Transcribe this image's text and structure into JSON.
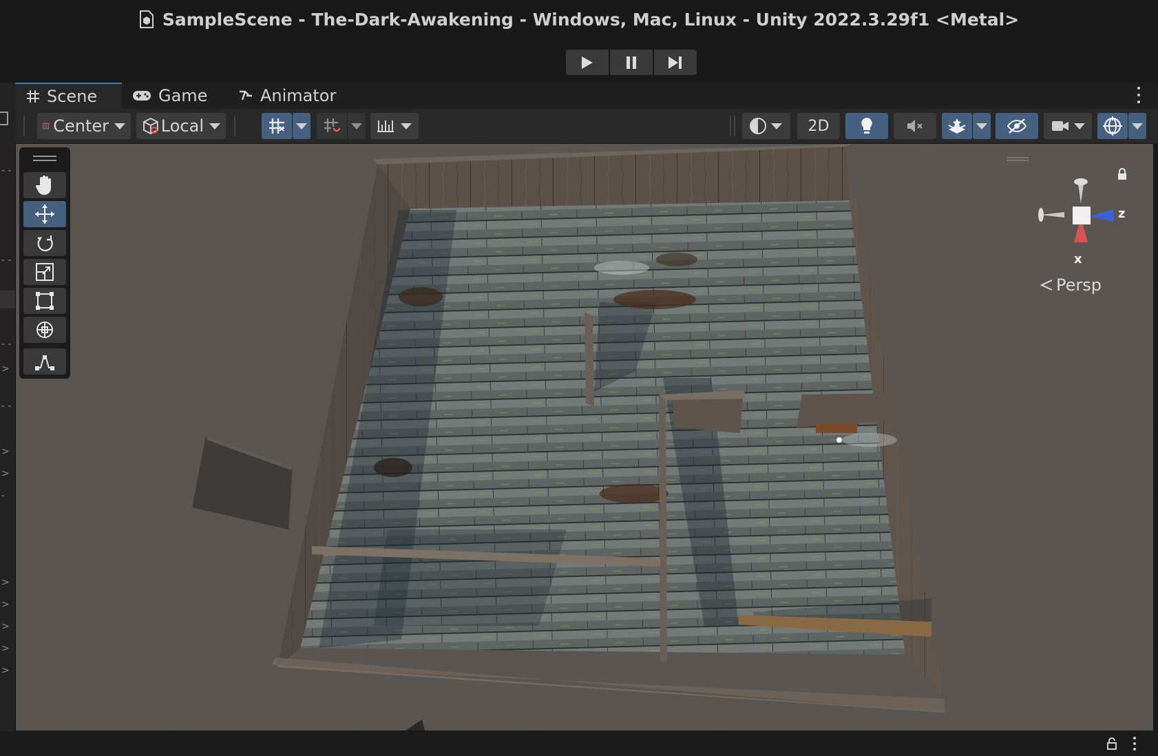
{
  "window": {
    "title": "SampleScene - The-Dark-Awakening - Windows, Mac, Linux - Unity 2022.3.29f1 <Metal>"
  },
  "play_controls": {
    "icons": [
      "play-icon",
      "pause-icon",
      "step-icon"
    ]
  },
  "tabs": [
    {
      "label": "Scene",
      "icon": "grid-hash-icon",
      "active": true
    },
    {
      "label": "Game",
      "icon": "gamepad-icon",
      "active": false
    },
    {
      "label": "Animator",
      "icon": "animator-icon",
      "active": false
    }
  ],
  "toolbar": {
    "pivot_mode": "Center",
    "pivot_rotation": "Local",
    "view_2d": "2D"
  },
  "tools": [
    "hand-tool",
    "move-tool",
    "rotate-tool",
    "scale-tool",
    "rect-tool",
    "transform-tool",
    "custom-tool"
  ],
  "gizmo": {
    "z_label": "z",
    "x_label": "x",
    "projection": "Persp"
  },
  "colors": {
    "accent": "#46607f",
    "viewport_background": "#5a5550",
    "axis_x": "#d9534f",
    "axis_z": "#4a6fdc"
  }
}
